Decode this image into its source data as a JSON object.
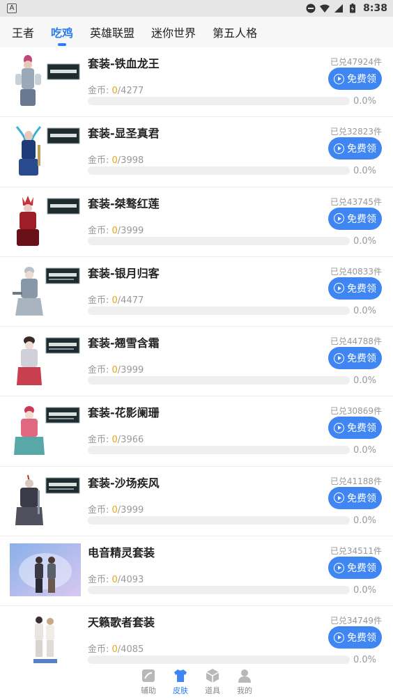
{
  "status_bar": {
    "app_letter": "A",
    "time": "8:38"
  },
  "tabs": [
    {
      "label": "王者",
      "active": false
    },
    {
      "label": "吃鸡",
      "active": true
    },
    {
      "label": "英雄联盟",
      "active": false
    },
    {
      "label": "迷你世界",
      "active": false
    },
    {
      "label": "第五人格",
      "active": false
    }
  ],
  "claim_label": "免费领",
  "coin_label": "金币: ",
  "items": [
    {
      "title": "套装-铁血龙王",
      "sold": "已兑47924件",
      "current": "0",
      "total": "/4277",
      "percent_text": "0.0%",
      "progress": 0.0
    },
    {
      "title": "套装-显圣真君",
      "sold": "已兑32823件",
      "current": "0",
      "total": "/3998",
      "percent_text": "0.0%",
      "progress": 0.0
    },
    {
      "title": "套装-桀骜红莲",
      "sold": "已兑43745件",
      "current": "0",
      "total": "/3999",
      "percent_text": "0.0%",
      "progress": 0.0
    },
    {
      "title": "套装-银月归客",
      "sold": "已兑40833件",
      "current": "0",
      "total": "/4477",
      "percent_text": "0.0%",
      "progress": 0.0
    },
    {
      "title": "套装-翘雪含霜",
      "sold": "已兑44788件",
      "current": "0",
      "total": "/3999",
      "percent_text": "0.0%",
      "progress": 0.0
    },
    {
      "title": "套装-花影阑珊",
      "sold": "已兑30869件",
      "current": "0",
      "total": "/3966",
      "percent_text": "0.0%",
      "progress": 0.0
    },
    {
      "title": "套装-沙场疾风",
      "sold": "已兑41188件",
      "current": "0",
      "total": "/3999",
      "percent_text": "0.0%",
      "progress": 0.0
    },
    {
      "title": "电音精灵套装",
      "sold": "已兑34511件",
      "current": "0",
      "total": "/4093",
      "percent_text": "0.0%",
      "progress": 0.0
    },
    {
      "title": "天籁歌者套装",
      "sold": "已兑34749件",
      "current": "0",
      "total": "/4085",
      "percent_text": "0.0%",
      "progress": 0.0
    }
  ],
  "bottom_nav": [
    {
      "label": "辅助",
      "icon": "tool-icon",
      "active": false
    },
    {
      "label": "皮肤",
      "icon": "shirt-icon",
      "active": true
    },
    {
      "label": "道具",
      "icon": "box-icon",
      "active": false
    },
    {
      "label": "我的",
      "icon": "user-icon",
      "active": false
    }
  ],
  "colors": {
    "accent": "#3f86f3",
    "coin_current": "#e6a817"
  }
}
